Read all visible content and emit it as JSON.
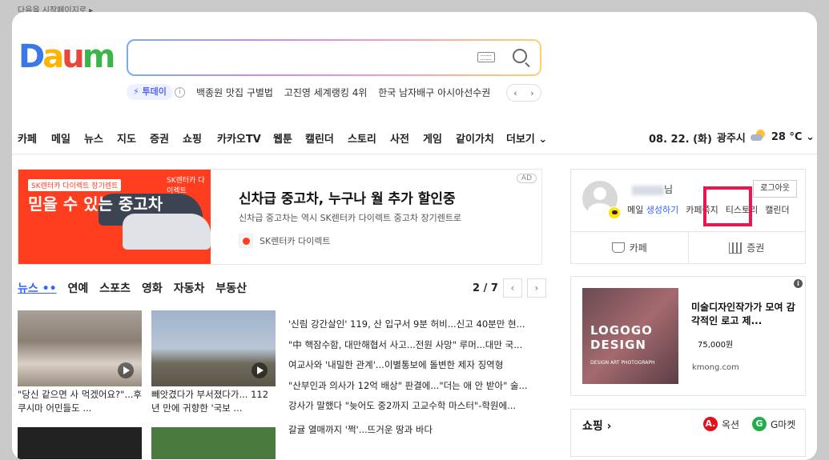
{
  "startpage_link": "다음을 시작페이지로 ▸",
  "logo_text": "Daum",
  "search": {
    "value": "",
    "today_badge": "⚡ 투데이",
    "info": "i",
    "keywords": [
      "백종원 맛집 구별법",
      "고진영 세계랭킹 4위",
      "한국 남자배구 아시아선수권"
    ],
    "nav_prev": "‹",
    "nav_next": "›"
  },
  "gnb": {
    "items": [
      "카페",
      "메일",
      "뉴스",
      "지도",
      "증권",
      "쇼핑",
      "카카오TV",
      "웹툰",
      "캘린더",
      "스토리",
      "사전",
      "게임",
      "같이가치",
      "더보기 ⌄"
    ],
    "date": "08. 22. (화)",
    "city": "광주시",
    "temp": "28 °C ⌄"
  },
  "ad": {
    "brand_tag": "SK렌터카 다이렉트 장기렌트",
    "sk_label": "SK렌터카 다이렉트",
    "headline": "믿을 수 있는 중고차",
    "title": "신차급 중고차, 누구나 월 추가 할인중",
    "desc": "신차급 중고차는 역시 SK렌터카 다이렉트 중고차 장기렌트로",
    "source": "SK렌터카 다이렉트",
    "badge": "AD"
  },
  "news": {
    "tabs": [
      "뉴스 ••",
      "연예",
      "스포츠",
      "영화",
      "자동차",
      "부동산"
    ],
    "page": "2 / 7",
    "prev": "‹",
    "next": "›",
    "thumb_captions": [
      "\"당신 같으면 사 먹겠어요?\"...후쿠시마 어민들도 ...",
      "빼앗겼다가 부서졌다가... 112년 만에 귀향한 '국보 ..."
    ],
    "headlines": [
      "'신림 강간살인' 119, 산 입구서 9분 허비...신고 40분만 현...",
      "\"中 핵잠수함, 대만해협서 사고...전원 사망\" 루머...대만 국...",
      "여교사와 '내밀한 관계'...이별통보에 돌변한 제자 징역형",
      "\"산부인과 의사가 12억 배상\" 판결에...\"더는 애 안 받아\" 술...",
      "강사가 말했다 \"늦어도 중2까지 고교수학 마스터\"-학원에...",
      "갈귤 열매까지 '쩍'...뜨거운 땅과 바다"
    ]
  },
  "login": {
    "username_suffix": "님",
    "logout": "로그아웃",
    "mail_label": "메일",
    "mail_action": "생성하기",
    "kakao": "카페쪽지",
    "tistory": "티스토리",
    "calendar": "캘린더",
    "cafe": "카페",
    "stock": "증권"
  },
  "ad2": {
    "info": "i",
    "logo": "LOGOGO DESIGN",
    "logo_sub": "DESIGN ART PHOTOGRAPH",
    "title": "미술디자인작가가 모여 감각적인 로고 제...",
    "price": "75,000원",
    "domain": "kmong.com"
  },
  "shopping": {
    "title": "쇼핑 ›",
    "auction_icon": "A.",
    "auction": "옥션",
    "gmarket_icon": "G",
    "gmarket": "G마켓"
  },
  "colors": {
    "accent": "#3366ff",
    "highlight": "#f0144c",
    "ad_red": "#ff3d1f"
  }
}
